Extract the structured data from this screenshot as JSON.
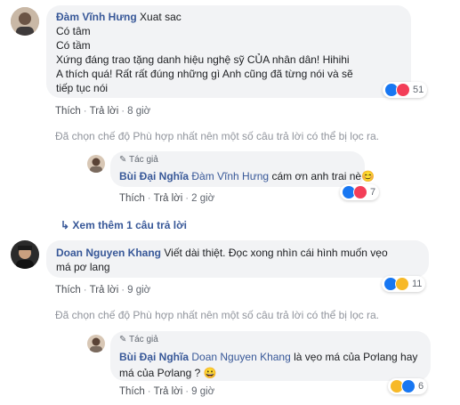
{
  "comments": [
    {
      "author": "Đàm Vĩnh Hưng",
      "lines": [
        "Xuat sac",
        "Có tâm",
        "Có tầm",
        "Xứng đáng trao tặng danh hiệu nghệ sỹ CỦA nhân dân! Hihihi",
        "A thích quá! Rất rất đúng những gì Anh cũng đã từng nói và sẽ",
        "tiếp tục nói"
      ],
      "like": "Thích",
      "reply": "Trả lời",
      "time": "8 giờ",
      "reaction_count": "51"
    },
    {
      "author": "Doan Nguyen Khang",
      "lines": [
        "Viết dài thiệt. Đọc xong nhìn cái hình muốn vẹo",
        "má pơ lang"
      ],
      "like": "Thích",
      "reply": "Trả lời",
      "time": "9 giờ",
      "reaction_count": "11"
    }
  ],
  "replies": [
    {
      "badge": "Tác giả",
      "author": "Bùi Đại Nghĩa",
      "tag": "Đàm Vĩnh Hưng",
      "text": "cám ơn anh trai nè😊",
      "like": "Thích",
      "reply": "Trả lời",
      "time": "2 giờ",
      "reaction_count": "7"
    },
    {
      "badge": "Tác giả",
      "author": "Bùi Đại Nghĩa",
      "tag": "Doan Nguyen Khang",
      "text_line1": "là vẹo má của Pơlang hay",
      "text_line2": "má của Pơlang ? 😀",
      "like": "Thích",
      "reply": "Trả lời",
      "time": "9 giờ",
      "reaction_count": "6"
    }
  ],
  "filter_notice": "Đã chọn chế độ Phù hợp nhất nên một số câu trả lời có thể bị lọc ra.",
  "view_more": "Xem thêm 1 câu trả lời",
  "colors": {
    "link": "#385898",
    "bubble": "#f2f3f5",
    "meta": "#616770"
  }
}
